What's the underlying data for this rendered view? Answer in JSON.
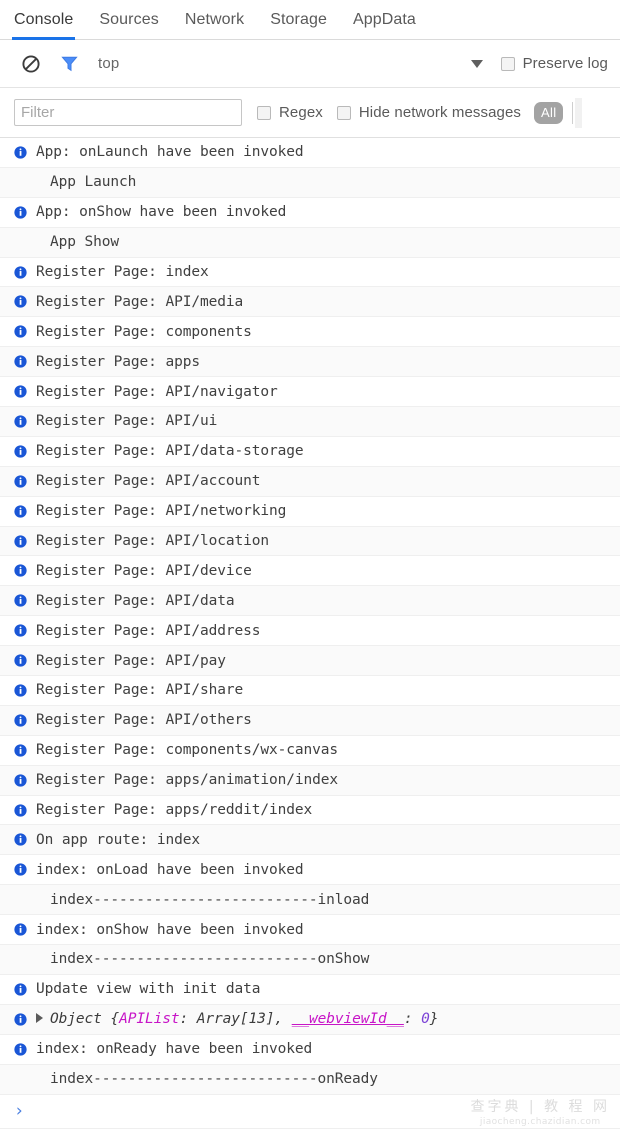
{
  "devtools": {
    "tabs": [
      {
        "label": "Console",
        "active": true
      },
      {
        "label": "Sources",
        "active": false
      },
      {
        "label": "Network",
        "active": false
      },
      {
        "label": "Storage",
        "active": false
      },
      {
        "label": "AppData",
        "active": false
      }
    ],
    "toolbar": {
      "clear_icon": "clear-console-icon",
      "filter_icon": "filter-funnel-icon",
      "context_selector": "top",
      "context_caret_icon": "chevron-down-icon",
      "preserve_log_label": "Preserve log",
      "preserve_log_checked": false
    },
    "filterbar": {
      "filter_placeholder": "Filter",
      "filter_value": "",
      "regex_label": "Regex",
      "regex_checked": false,
      "hide_network_label": "Hide network messages",
      "hide_network_checked": false,
      "level_badge": "All"
    },
    "prompt": {
      "chevron": "›",
      "value": ""
    },
    "colors": {
      "accent": "#1a73e8",
      "info_icon": "#1a56d6",
      "badge_bg": "#a3a3a3",
      "object_key": "#c715c7",
      "object_number": "#7b42d6",
      "prompt_chevron": "#4a7fe0"
    }
  },
  "log": {
    "entries": [
      {
        "icon": "info",
        "text": "App: onLaunch have been invoked"
      },
      {
        "icon": "none",
        "text": "App Launch"
      },
      {
        "icon": "info",
        "text": "App: onShow have been invoked"
      },
      {
        "icon": "none",
        "text": "App Show"
      },
      {
        "icon": "info",
        "text": "Register Page: index"
      },
      {
        "icon": "info",
        "text": "Register Page: API/media"
      },
      {
        "icon": "info",
        "text": "Register Page: components"
      },
      {
        "icon": "info",
        "text": "Register Page: apps"
      },
      {
        "icon": "info",
        "text": "Register Page: API/navigator"
      },
      {
        "icon": "info",
        "text": "Register Page: API/ui"
      },
      {
        "icon": "info",
        "text": "Register Page: API/data-storage"
      },
      {
        "icon": "info",
        "text": "Register Page: API/account"
      },
      {
        "icon": "info",
        "text": "Register Page: API/networking"
      },
      {
        "icon": "info",
        "text": "Register Page: API/location"
      },
      {
        "icon": "info",
        "text": "Register Page: API/device"
      },
      {
        "icon": "info",
        "text": "Register Page: API/data"
      },
      {
        "icon": "info",
        "text": "Register Page: API/address"
      },
      {
        "icon": "info",
        "text": "Register Page: API/pay"
      },
      {
        "icon": "info",
        "text": "Register Page: API/share"
      },
      {
        "icon": "info",
        "text": "Register Page: API/others"
      },
      {
        "icon": "info",
        "text": "Register Page: components/wx-canvas"
      },
      {
        "icon": "info",
        "text": "Register Page: apps/animation/index"
      },
      {
        "icon": "info",
        "text": "Register Page: apps/reddit/index"
      },
      {
        "icon": "info",
        "text": "On app route: index"
      },
      {
        "icon": "info",
        "text": "index: onLoad have been invoked"
      },
      {
        "icon": "none",
        "text": "index--------------------------inload"
      },
      {
        "icon": "info",
        "text": "index: onShow have been invoked"
      },
      {
        "icon": "none",
        "text": "index--------------------------onShow"
      },
      {
        "icon": "info",
        "text": "Update view with init data"
      },
      {
        "icon": "info",
        "type": "object",
        "object": {
          "disclosure": "▶",
          "name": "Object",
          "open_brace": "{",
          "props": [
            {
              "key": "APIList",
              "underline": false,
              "sep": ": ",
              "value": "Array[13]",
              "value_kind": "text"
            },
            {
              "key": "__webviewId__",
              "underline": true,
              "sep": ": ",
              "value": "0",
              "value_kind": "number"
            }
          ],
          "comma": ", ",
          "close_brace": "}"
        }
      },
      {
        "icon": "info",
        "text": "index: onReady have been invoked"
      },
      {
        "icon": "none",
        "text": "index--------------------------onReady"
      }
    ]
  },
  "watermark": {
    "title": "查字典 | 教 程 网",
    "url": "jiaocheng.chazidian.com"
  }
}
